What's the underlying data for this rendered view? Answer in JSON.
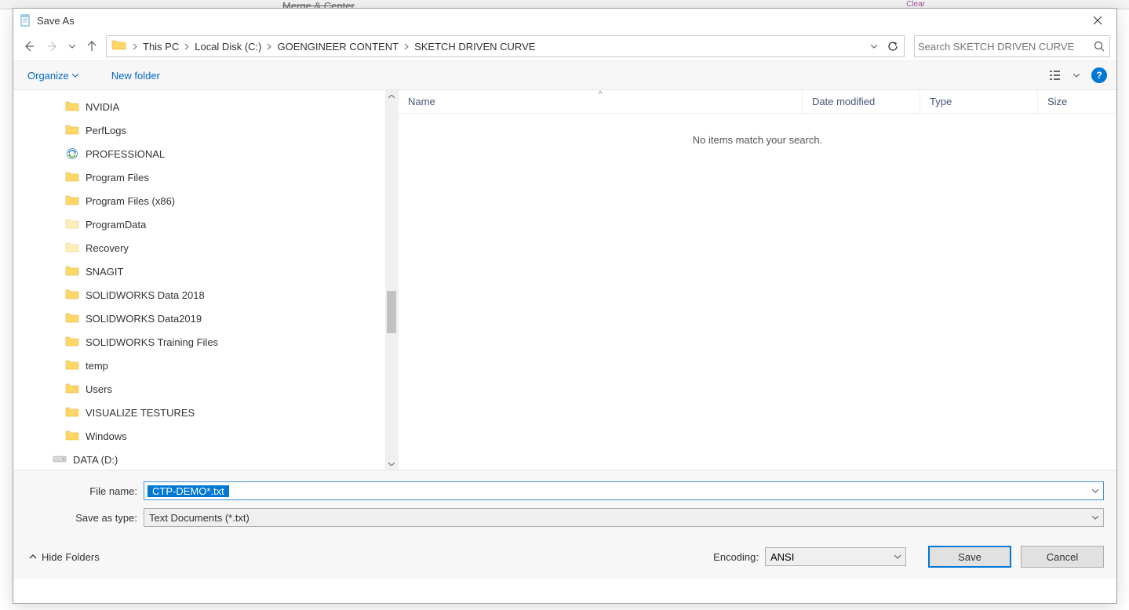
{
  "dialog": {
    "title": "Save As",
    "close_tooltip": "Close"
  },
  "breadcrumb": {
    "items": [
      "This PC",
      "Local Disk (C:)",
      "GOENGINEER CONTENT",
      "SKETCH DRIVEN CURVE"
    ]
  },
  "search": {
    "placeholder": "Search SKETCH DRIVEN CURVE"
  },
  "toolbar": {
    "organize": "Organize",
    "newfolder": "New folder"
  },
  "tree": {
    "items": [
      {
        "label": "NVIDIA",
        "icon": "folder"
      },
      {
        "label": "PerfLogs",
        "icon": "folder"
      },
      {
        "label": "PROFESSIONAL",
        "icon": "sync"
      },
      {
        "label": "Program Files",
        "icon": "folder"
      },
      {
        "label": "Program Files (x86)",
        "icon": "folder"
      },
      {
        "label": "ProgramData",
        "icon": "folder-light"
      },
      {
        "label": "Recovery",
        "icon": "folder-light"
      },
      {
        "label": "SNAGIT",
        "icon": "folder"
      },
      {
        "label": "SOLIDWORKS Data 2018",
        "icon": "folder"
      },
      {
        "label": "SOLIDWORKS Data2019",
        "icon": "folder"
      },
      {
        "label": "SOLIDWORKS Training Files",
        "icon": "folder"
      },
      {
        "label": "temp",
        "icon": "folder"
      },
      {
        "label": "Users",
        "icon": "folder"
      },
      {
        "label": "VISUALIZE TESTURES",
        "icon": "folder"
      },
      {
        "label": "Windows",
        "icon": "folder"
      },
      {
        "label": "DATA (D:)",
        "icon": "drive"
      }
    ]
  },
  "columns": {
    "name": "Name",
    "date": "Date modified",
    "type": "Type",
    "size": "Size"
  },
  "filelist": {
    "empty": "No items match your search."
  },
  "form": {
    "filename_label": "File name:",
    "filename_value": "CTP-DEMO*.txt",
    "filetype_label": "Save as type:",
    "filetype_value": "Text Documents (*.txt)"
  },
  "actions": {
    "hide_folders": "Hide Folders",
    "encoding_label": "Encoding:",
    "encoding_value": "ANSI",
    "save": "Save",
    "cancel": "Cancel"
  },
  "bg": {
    "ribbon_hint": "Merge & Center",
    "clear": "Clear"
  }
}
